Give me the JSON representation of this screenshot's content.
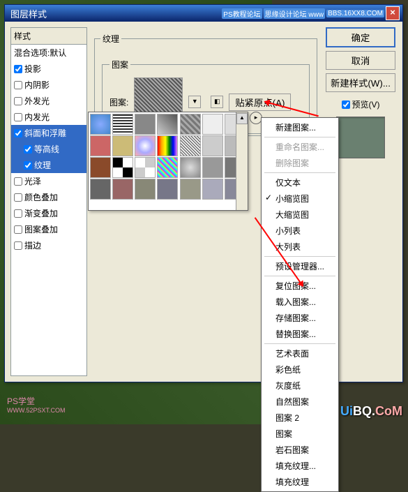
{
  "dialog": {
    "title": "图层样式",
    "badges": [
      "PS教程论坛",
      "思缘设计论坛 www",
      "BBS.16XX8.COM"
    ]
  },
  "styles": {
    "header": "样式",
    "blend_default": "混合选项:默认",
    "drop_shadow": "投影",
    "inner_shadow": "内阴影",
    "outer_glow": "外发光",
    "inner_glow": "内发光",
    "bevel_emboss": "斜面和浮雕",
    "contour": "等高线",
    "texture": "纹理",
    "satin": "光泽",
    "color_overlay": "颜色叠加",
    "gradient_overlay": "渐变叠加",
    "pattern_overlay": "图案叠加",
    "stroke": "描边"
  },
  "texture": {
    "group_label": "纹理",
    "pattern_group": "图案",
    "pattern_label": "图案:",
    "snap_origin": "贴紧原点(A)"
  },
  "menu": {
    "new_pattern": "新建图案...",
    "rename": "重命名图案...",
    "delete": "删除图案",
    "text_only": "仅文本",
    "small_thumb": "小缩览图",
    "large_thumb": "大缩览图",
    "small_list": "小列表",
    "large_list": "大列表",
    "preset_manager": "预设管理器...",
    "reset": "复位图案...",
    "load": "载入图案...",
    "save": "存储图案...",
    "replace": "替换图案...",
    "art_surfaces": "艺术表面",
    "color_paper": "彩色纸",
    "gray_paper": "灰度纸",
    "nature": "自然图案",
    "patterns2": "图案 2",
    "patterns": "图案",
    "rock": "岩石图案",
    "fill_texture": "填充纹理...",
    "fill_texture2": "填充纹理"
  },
  "buttons": {
    "ok": "确定",
    "cancel": "取消",
    "new_style": "新建样式(W)...",
    "preview": "预览(V)"
  },
  "ps_badge": {
    "name": "PS学堂",
    "url": "WWW.52PSXT.COM"
  },
  "watermark": {
    "ui": "Ui",
    "bq": "BQ.",
    "com": "CoM"
  }
}
